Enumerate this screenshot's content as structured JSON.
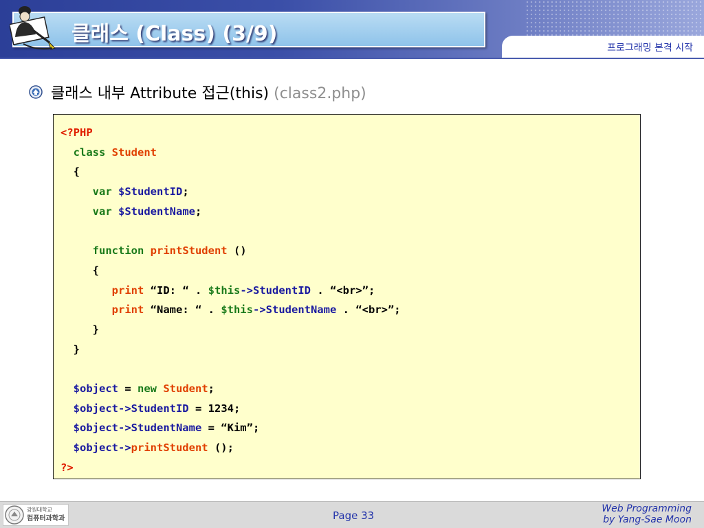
{
  "header": {
    "title": "클래스 (Class) (3/9)",
    "subtitle": "프로그래밍 본격 시작"
  },
  "bullet": {
    "text": "클래스 내부 Attribute 접근(this)",
    "file": "(class2.php)"
  },
  "code": {
    "l1": "<?PHP",
    "l2a": "  class ",
    "l2b": "Student",
    "l3": "  {",
    "l4a": "     var ",
    "l4b": "$StudentID",
    "l4c": ";",
    "l5a": "     var ",
    "l5b": "$StudentName",
    "l5c": ";",
    "l7a": "     function ",
    "l7b": "printStudent",
    "l7c": " ()",
    "l8": "     {",
    "l9a": "        print",
    "l9b": " “ID: “ . ",
    "l9c": "$this",
    "l9d": "->",
    "l9e": "StudentID",
    "l9f": " . “<br>”;",
    "l10a": "        print",
    "l10b": " “Name: “ . ",
    "l10c": "$this",
    "l10d": "->",
    "l10e": "StudentName",
    "l10f": " . “<br>”;",
    "l11": "     }",
    "l12": "  }",
    "l14a": "  $object",
    "l14b": " = ",
    "l14c": "new",
    "l14d": " ",
    "l14e": "Student",
    "l14f": ";",
    "l15a": "  $object->",
    "l15b": "StudentID",
    "l15c": " = 1234;",
    "l16a": "  $object->",
    "l16b": "StudentName",
    "l16c": " = “Kim”;",
    "l17a": "  $object->",
    "l17b": "printStudent",
    "l17c": " ();",
    "l18": "?>"
  },
  "footer": {
    "university_name": "강원대학교",
    "department_name": "컴퓨터과학과",
    "page": "Page 33",
    "course": "Web Programming",
    "author": "by Yang-Sae Moon"
  },
  "colors": {
    "band": "#3b4fa8",
    "code_background": "#ffffcc",
    "keyword_red": "#e02000",
    "keyword_green": "#1a7a1a",
    "variable_blue": "#1a1aa0"
  },
  "icons": {
    "header_logo": "person-writing-icon",
    "bullet": "university-emblem-icon",
    "footer": "university-seal-icon"
  }
}
